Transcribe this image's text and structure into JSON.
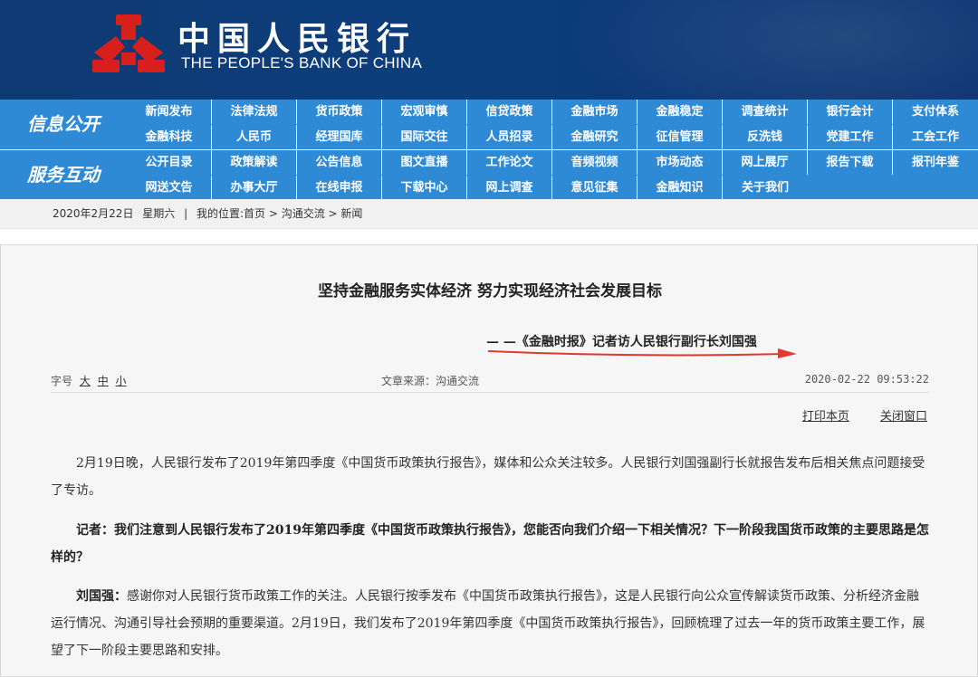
{
  "header": {
    "bank_name_cn": "中国人民银行",
    "bank_name_en": "THE PEOPLE'S BANK OF CHINA",
    "logo_icon": "pboc-emblem-icon",
    "colors": {
      "banner": "#0d3e7c",
      "nav": "#2f8ad6",
      "logo_red": "#d7201c"
    }
  },
  "nav": {
    "section1": {
      "title": "信息公开",
      "row1": [
        "新闻发布",
        "法律法规",
        "货币政策",
        "宏观审慎",
        "信贷政策",
        "金融市场",
        "金融稳定",
        "调查统计",
        "银行会计",
        "支付体系"
      ],
      "row2": [
        "金融科技",
        "人民币",
        "经理国库",
        "国际交往",
        "人员招录",
        "金融研究",
        "征信管理",
        "反洗钱",
        "党建工作",
        "工会工作"
      ]
    },
    "section2": {
      "title": "服务互动",
      "row1": [
        "公开目录",
        "政策解读",
        "公告信息",
        "图文直播",
        "工作论文",
        "音频视频",
        "市场动态",
        "网上展厅",
        "报告下载",
        "报刊年鉴"
      ],
      "row2": [
        "网送文告",
        "办事大厅",
        "在线申报",
        "下载中心",
        "网上调查",
        "意见征集",
        "金融知识",
        "关于我们"
      ]
    }
  },
  "breadcrumb": {
    "date": "2020年2月22日",
    "weekday": "星期六",
    "separator": "|",
    "location_label": "我的位置:",
    "path": "首页 > 沟通交流 > 新闻"
  },
  "article": {
    "title": "坚持金融服务实体经济 努力实现经济社会发展目标",
    "subtitle": "— —《金融时报》记者访人民银行副行长刘国强",
    "font_size_label": "字号",
    "font_sizes": [
      "大",
      "中",
      "小"
    ],
    "source": "文章来源：沟通交流",
    "datetime": "2020-02-22 09:53:22",
    "print_label": "打印本页",
    "close_label": "关闭窗口",
    "p1": "2月19日晚，人民银行发布了2019年第四季度《中国货币政策执行报告》，媒体和公众关注较多。人民银行刘国强副行长就报告发布后相关焦点问题接受了专访。",
    "p2": "记者：我们注意到人民银行发布了2019年第四季度《中国货币政策执行报告》，您能否向我们介绍一下相关情况？下一阶段我国货币政策的主要思路是怎样的？",
    "p3_speaker": "刘国强：",
    "p3": "感谢你对人民银行货币政策工作的关注。人民银行按季发布《中国货币政策执行报告》，这是人民银行向公众宣传解读货币政策、分析经济金融运行情况、沟通引导社会预期的重要渠道。2月19日，我们发布了2019年第四季度《中国货币政策执行报告》，回顾梳理了过去一年的货币政策主要工作，展望了下一阶段主要思路和安排。"
  }
}
